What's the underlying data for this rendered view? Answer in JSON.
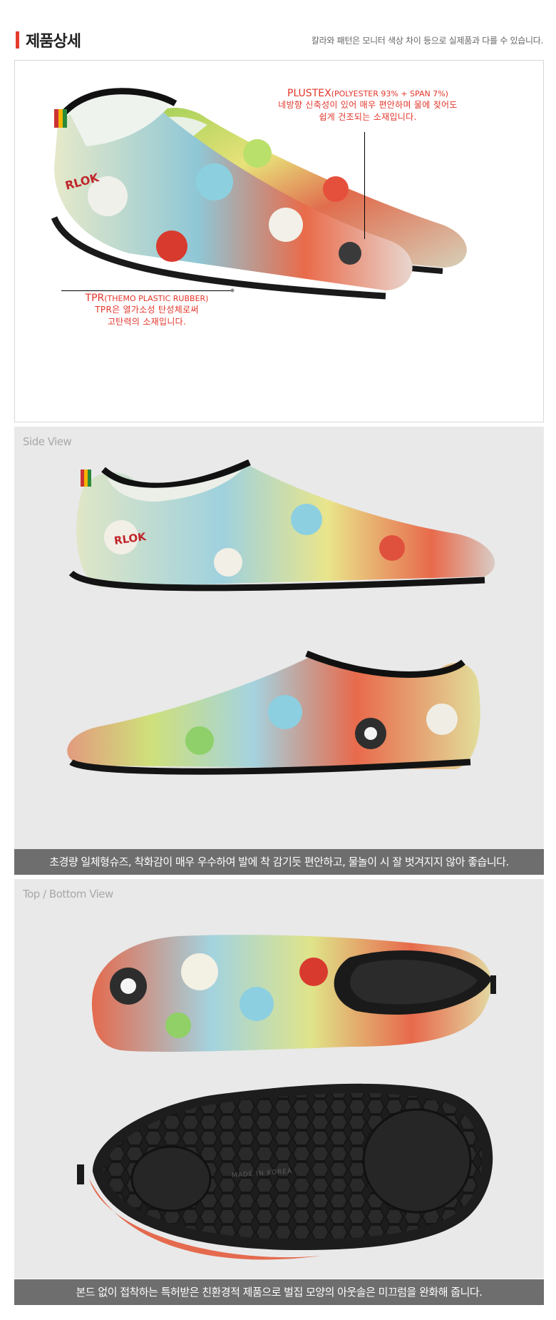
{
  "header": {
    "title": "제품상세",
    "notice": "칼라와 패턴은 모니터 색상 차이 등으로 실제품과 다를 수 있습니다."
  },
  "materials": {
    "upper": {
      "name": "PLUSTEX",
      "spec": "(POLYESTER 93% + SPAN 7%)",
      "line1": "네방향 신축성이 있어 매우 편안하며 물에 젖어도",
      "line2": "쉽게 건조되는 소재입니다."
    },
    "sole": {
      "name": "TPR",
      "spec": "(THEMO PLASTIC RUBBER)",
      "line1": "TPR은 열가소성 탄성체로써",
      "line2": "고탄력의 소재입니다."
    },
    "brand_mark": "RLOK"
  },
  "side_view": {
    "label": "Side View",
    "caption": "초경량 일체형슈즈, 착화감이 매우 우수하여 발에 착 감기듯 편안하고, 물놀이 시 잘 벗겨지지 않아 좋습니다."
  },
  "top_view": {
    "label": "Top / Bottom View",
    "caption": "본드 없이 접착하는 특허받은 친환경적 제품으로 벌집 모양의 아웃솔은 미끄럼을 완화해 줍니다.",
    "sole_imprint": "MADE IN KOREA"
  },
  "colors": {
    "accent": "#e53a2a",
    "caption_bg": "#6e6e6e",
    "panel_bg": "#e9e9e9"
  }
}
